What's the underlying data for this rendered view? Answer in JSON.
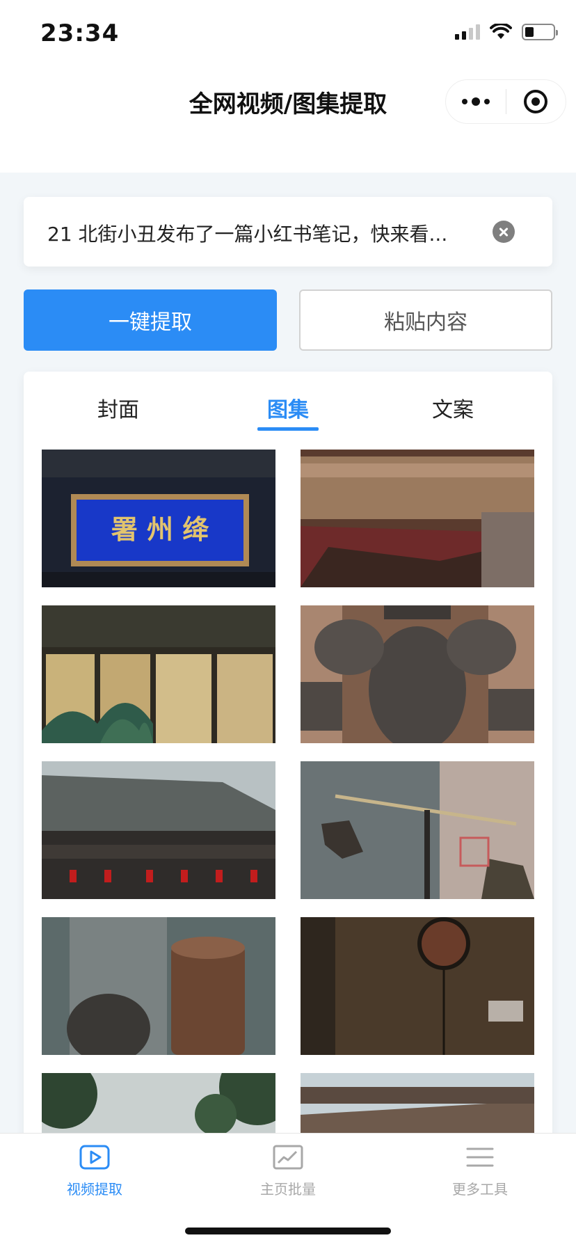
{
  "status_bar": {
    "time": "23:34"
  },
  "nav": {
    "title": "全网视频/图集提取"
  },
  "input": {
    "value": "21 北街小丑发布了一篇小红书笔记，快来看..."
  },
  "buttons": {
    "extract": "一键提取",
    "paste": "粘贴内容"
  },
  "tabs": [
    {
      "label": "封面",
      "active": false
    },
    {
      "label": "图集",
      "active": true
    },
    {
      "label": "文案",
      "active": false
    }
  ],
  "gallery": {
    "plaque_text": "署 州 绛",
    "images": [
      "plaque-image",
      "timber-beam-image",
      "painted-screen-image",
      "armor-image",
      "temple-roof-image",
      "balance-scale-image",
      "pottery-jars-image",
      "wooden-door-image",
      "trees-image",
      "eaves-image"
    ]
  },
  "tabbar": [
    {
      "label": "视频提取",
      "icon": "video-play-icon",
      "active": true
    },
    {
      "label": "主页批量",
      "icon": "chart-icon",
      "active": false
    },
    {
      "label": "更多工具",
      "icon": "menu-lines-icon",
      "active": false
    }
  ],
  "colors": {
    "accent": "#2b8cf5",
    "background": "#f2f6f9"
  }
}
